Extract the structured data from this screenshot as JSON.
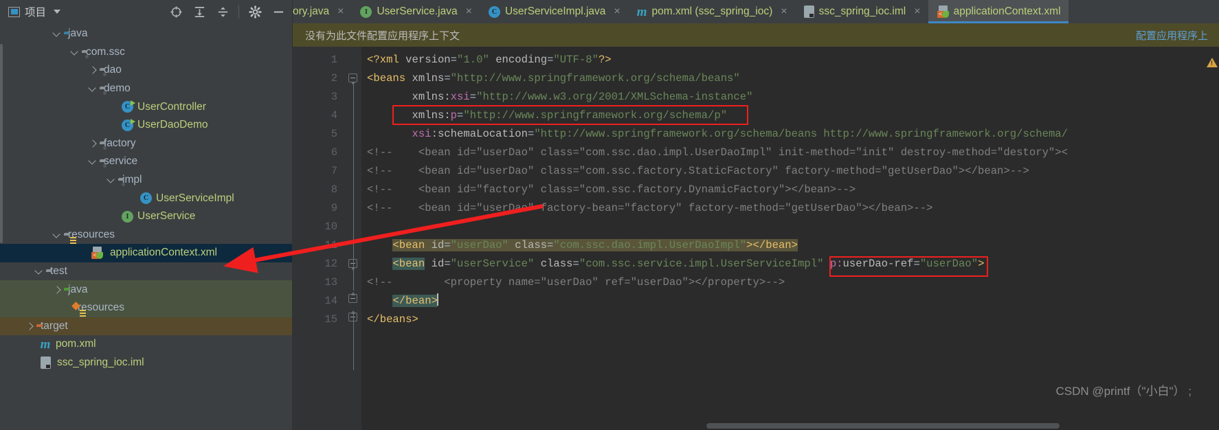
{
  "project_panel": {
    "title": "项目",
    "window_icon": "window-icon",
    "dropdown_icon": "chevron-down-icon",
    "toolbar": [
      {
        "name": "locate-icon",
        "label": ""
      },
      {
        "name": "expand-all-icon",
        "label": ""
      },
      {
        "name": "collapse-all-icon",
        "label": ""
      },
      {
        "name": "settings-gear-icon",
        "label": ""
      },
      {
        "name": "hide-minimize-icon",
        "label": ""
      }
    ],
    "tree": [
      {
        "label": "java",
        "indent": 4,
        "arrow": "down",
        "icon": "folder-blue",
        "color": "gray"
      },
      {
        "label": "com.ssc",
        "indent": 5,
        "arrow": "down",
        "icon": "folder-package",
        "color": "gray"
      },
      {
        "label": "dao",
        "indent": 6,
        "arrow": "right",
        "icon": "folder-package",
        "color": "gray"
      },
      {
        "label": "demo",
        "indent": 6,
        "arrow": "down",
        "icon": "folder-package",
        "color": "gray"
      },
      {
        "label": "UserController",
        "indent": 8,
        "arrow": "none",
        "icon": "class-runnable-icon",
        "color": "green"
      },
      {
        "label": "UserDaoDemo",
        "indent": 8,
        "arrow": "none",
        "icon": "class-runnable-icon",
        "color": "green"
      },
      {
        "label": "factory",
        "indent": 6,
        "arrow": "right",
        "icon": "folder-package",
        "color": "gray"
      },
      {
        "label": "service",
        "indent": 6,
        "arrow": "down",
        "icon": "folder-package",
        "color": "gray"
      },
      {
        "label": "impl",
        "indent": 7,
        "arrow": "down",
        "icon": "folder-package",
        "color": "gray"
      },
      {
        "label": "UserServiceImpl",
        "indent": 9,
        "arrow": "none",
        "icon": "class-icon",
        "color": "green"
      },
      {
        "label": "UserService",
        "indent": 8,
        "arrow": "none",
        "icon": "interface-icon",
        "color": "green"
      },
      {
        "label": "resources",
        "indent": 4,
        "arrow": "down",
        "icon": "folder-resources",
        "color": "gray"
      },
      {
        "label": "applicationContext.xml",
        "indent": 6,
        "arrow": "none",
        "icon": "spring-xml-icon",
        "color": "green",
        "state": "selected"
      },
      {
        "label": "test",
        "indent": 3,
        "arrow": "down",
        "icon": "folder-gray",
        "color": "gray"
      },
      {
        "label": "java",
        "indent": 5,
        "arrow": "right",
        "icon": "folder-green",
        "color": "gray",
        "state": "test-source"
      },
      {
        "label": "resources",
        "indent": 5,
        "arrow": "none",
        "icon": "folder-test-resources",
        "color": "gray",
        "state": "test-source"
      },
      {
        "label": "target",
        "indent": 2,
        "arrow": "right",
        "icon": "folder-orange",
        "color": "gray",
        "state": "excluded"
      },
      {
        "label": "pom.xml",
        "indent": 3,
        "arrow": "none",
        "icon": "maven-icon",
        "color": "green"
      },
      {
        "label": "ssc_spring_ioc.iml",
        "indent": 3,
        "arrow": "none",
        "icon": "iml-icon",
        "color": "green"
      }
    ]
  },
  "tabs": [
    {
      "label": "ory.java",
      "icon": "none",
      "close": "×",
      "active": false,
      "clipped": true
    },
    {
      "label": "UserService.java",
      "icon": "interface-icon",
      "close": "×",
      "active": false
    },
    {
      "label": "UserServiceImpl.java",
      "icon": "class-icon",
      "close": "×",
      "active": false
    },
    {
      "label": "pom.xml (ssc_spring_ioc)",
      "icon": "maven-icon",
      "close": "×",
      "active": false
    },
    {
      "label": "ssc_spring_ioc.iml",
      "icon": "iml-icon",
      "close": "×",
      "active": false
    },
    {
      "label": "applicationContext.xml",
      "icon": "spring-xml-icon",
      "close": "",
      "active": true
    }
  ],
  "notification": {
    "message": "没有为此文件配置应用程序上下文",
    "action_label": "配置应用程序上",
    "background": "#4e4b29"
  },
  "editor": {
    "line_numbers": [
      "1",
      "2",
      "3",
      "4",
      "5",
      "6",
      "7",
      "8",
      "9",
      "10",
      "11",
      "12",
      "13",
      "14",
      "15"
    ],
    "lines": [
      "<?xml version=\"1.0\" encoding=\"UTF-8\"?>",
      "<beans xmlns=\"http://www.springframework.org/schema/beans\"",
      "       xmlns:xsi=\"http://www.w3.org/2001/XMLSchema-instance\"",
      "       xmlns:p=\"http://www.springframework.org/schema/p\"",
      "       xsi:schemaLocation=\"http://www.springframework.org/schema/beans http://www.springframework.org/schema/",
      "<!--    <bean id=\"userDao\" class=\"com.ssc.dao.impl.UserDaoImpl\" init-method=\"init\" destroy-method=\"destory\"><",
      "<!--    <bean id=\"userDao\" class=\"com.ssc.factory.StaticFactory\" factory-method=\"getUserDao\"></bean>-->",
      "<!--    <bean id=\"factory\" class=\"com.ssc.factory.DynamicFactory\"></bean>-->",
      "<!--    <bean id=\"userDao\" factory-bean=\"factory\" factory-method=\"getUserDao\"></bean>-->",
      "",
      "    <bean id=\"userDao\" class=\"com.ssc.dao.impl.UserDaoImpl\"></bean>",
      "    <bean id=\"userService\" class=\"com.ssc.service.impl.UserServiceImpl\" p:userDao-ref=\"userDao\">",
      "<!--        <property name=\"userDao\" ref=\"userDao\"></property>-->",
      "    </bean>",
      "</beans>"
    ],
    "warning_icon": "warning-triangle-icon",
    "watermark": "CSDN @printf（\"小白\"）  ;"
  },
  "annotations": {
    "highlight_rect_1": "xmlns:p namespace declaration",
    "highlight_rect_2": "p:userDao-ref attribute",
    "arrow": "red-arrow-pointing-to-applicationContext-xml",
    "color": "#f01f1f"
  }
}
